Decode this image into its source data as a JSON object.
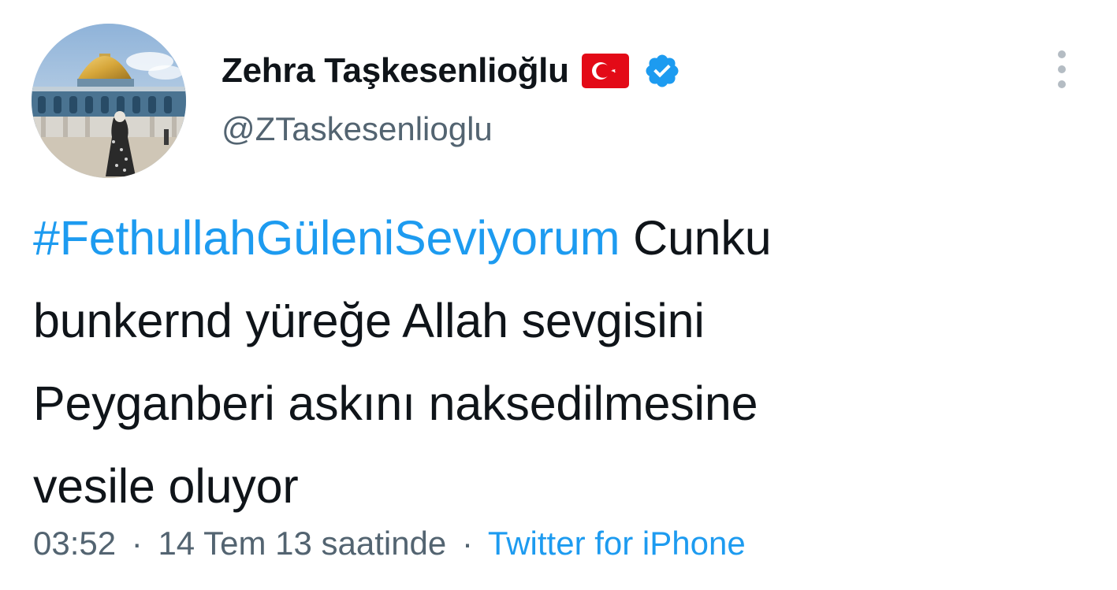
{
  "author": {
    "display_name": "Zehra Taşkesenlioğlu",
    "handle": "@ZTaskesenlioglu",
    "flag_icon": "turkey-flag-icon",
    "verified_icon": "verified-badge-icon"
  },
  "menu": {
    "icon": "more-options-icon"
  },
  "tweet": {
    "hashtag": "#FethullahGüleniSeviyorum",
    "line1_rest": " Cunku",
    "line2": "bunkernd yüreğe Allah sevgisini",
    "line3": "Peyganberi askını naksedilmesine",
    "line4": "vesile oluyor"
  },
  "meta": {
    "time": "03:52",
    "separator": "·",
    "date": "14 Tem 13 saatinde",
    "source": "Twitter for iPhone"
  },
  "colors": {
    "link": "#1d9bf0",
    "text": "#0f1419",
    "secondary": "#536471",
    "flag_red": "#e30a17"
  }
}
